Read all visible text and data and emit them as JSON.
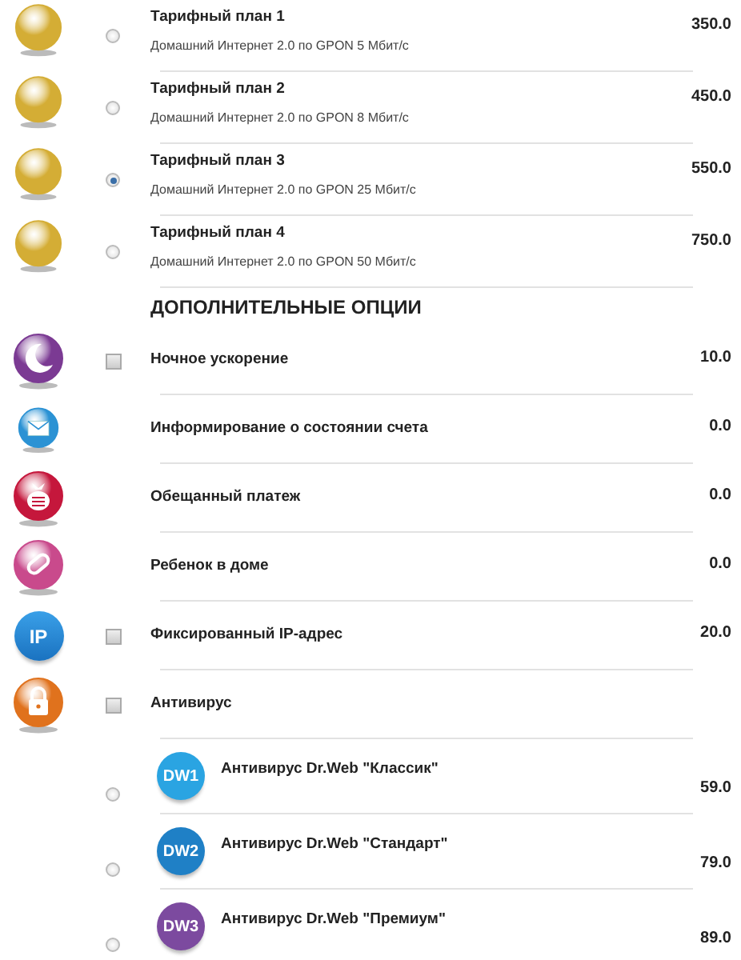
{
  "plans": [
    {
      "title": "Тарифный план 1",
      "description": "Домашний Интернет 2.0 по GPON 5 Мбит/с",
      "price": "350.0",
      "selected": false
    },
    {
      "title": "Тарифный план 2",
      "description": "Домашний Интернет 2.0 по GPON 8 Мбит/с",
      "price": "450.0",
      "selected": false
    },
    {
      "title": "Тарифный план 3",
      "description": "Домашний Интернет 2.0 по GPON 25 Мбит/с",
      "price": "550.0",
      "selected": true
    },
    {
      "title": "Тарифный план 4",
      "description": "Домашний Интернет 2.0 по GPON 50 Мбит/с",
      "price": "750.0",
      "selected": false
    }
  ],
  "options_heading": "ДОПОЛНИТЕЛЬНЫЕ ОПЦИИ",
  "options": [
    {
      "kind": "checkbox",
      "title": "Ночное ускорение",
      "price": "10.0",
      "checked": false
    },
    {
      "kind": "plain",
      "title": "Информирование о состоянии счета",
      "price": "0.0"
    },
    {
      "kind": "plain",
      "title": "Обещанный платеж",
      "price": "0.0"
    },
    {
      "kind": "plain",
      "title": "Ребенок в доме",
      "price": "0.0"
    },
    {
      "kind": "checkbox",
      "title": "Фиксированный IP-адрес",
      "price": "20.0",
      "checked": false,
      "icon_text": "IP"
    },
    {
      "kind": "checkbox",
      "title": "Антивирус",
      "checked": false
    }
  ],
  "antivirus": [
    {
      "badge": "DW1",
      "title": "Антивирус Dr.Web \"Классик\"",
      "price": "59.0",
      "selected": false
    },
    {
      "badge": "DW2",
      "title": "Антивирус Dr.Web \"Стандарт\"",
      "price": "79.0",
      "selected": false
    },
    {
      "badge": "DW3",
      "title": "Антивирус Dr.Web \"Премиум\"",
      "price": "89.0",
      "selected": false
    }
  ]
}
